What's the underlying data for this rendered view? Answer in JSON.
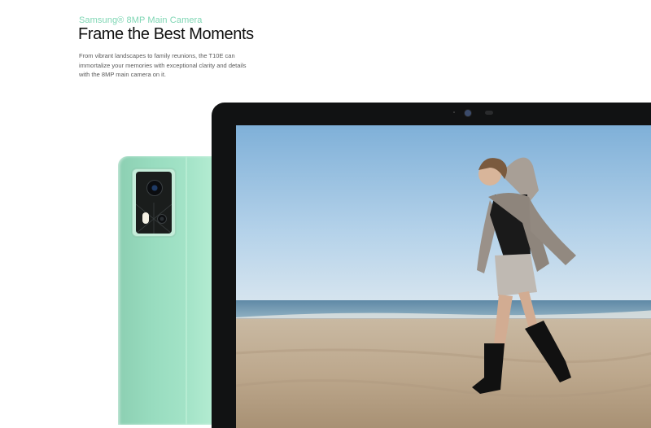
{
  "eyebrow": "Samsung® 8MP Main Camera",
  "headline": "Frame the Best Moments",
  "description": "From vibrant landscapes to family reunions, the T10E can immortalize your memories with exceptional clarity and details with the 8MP main camera on it.",
  "colors": {
    "accent": "#7fd6b4",
    "tablet_back": "#a3e3c7",
    "tablet_frame": "#111213"
  }
}
